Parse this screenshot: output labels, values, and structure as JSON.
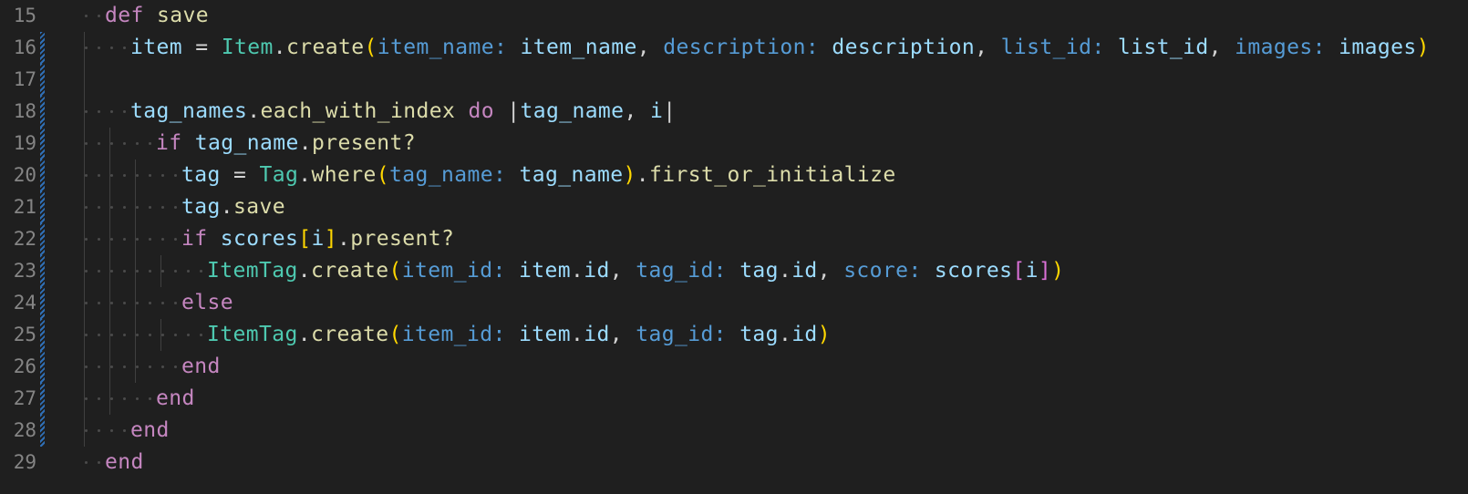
{
  "editor": {
    "language": "ruby",
    "theme_colors": {
      "background": "#1f1f1f",
      "line_number": "#858585",
      "keyword": "#c586c0",
      "function": "#dcdcaa",
      "class": "#4ec9b0",
      "variable": "#9cdcfe",
      "symbol_key": "#569cd6",
      "bracket_level1": "#ffd700",
      "bracket_level2": "#da70d6",
      "modified_gutter": "#2f6fb6"
    },
    "lines": [
      {
        "num": "15",
        "indent": 0,
        "modified": false,
        "tokens": [
          {
            "t": "def",
            "c": "kw"
          },
          {
            "t": " ",
            "c": "pun"
          },
          {
            "t": "save",
            "c": "fn"
          }
        ]
      },
      {
        "num": "16",
        "indent": 1,
        "modified": true,
        "tokens": [
          {
            "t": "item",
            "c": "var"
          },
          {
            "t": " = ",
            "c": "pun"
          },
          {
            "t": "Item",
            "c": "cls"
          },
          {
            "t": ".",
            "c": "pun"
          },
          {
            "t": "create",
            "c": "fn"
          },
          {
            "t": "(",
            "c": "br1"
          },
          {
            "t": "item_name:",
            "c": "sym"
          },
          {
            "t": " ",
            "c": "pun"
          },
          {
            "t": "item_name",
            "c": "var"
          },
          {
            "t": ", ",
            "c": "pun"
          },
          {
            "t": "description:",
            "c": "sym"
          },
          {
            "t": " ",
            "c": "pun"
          },
          {
            "t": "description",
            "c": "var"
          },
          {
            "t": ", ",
            "c": "pun"
          },
          {
            "t": "list_id:",
            "c": "sym"
          },
          {
            "t": " ",
            "c": "pun"
          },
          {
            "t": "list_id",
            "c": "var"
          },
          {
            "t": ", ",
            "c": "pun"
          },
          {
            "t": "images:",
            "c": "sym"
          },
          {
            "t": " ",
            "c": "pun"
          },
          {
            "t": "images",
            "c": "var"
          },
          {
            "t": ")",
            "c": "br1"
          }
        ]
      },
      {
        "num": "17",
        "indent": 0,
        "modified": true,
        "tokens": []
      },
      {
        "num": "18",
        "indent": 1,
        "modified": true,
        "tokens": [
          {
            "t": "tag_names",
            "c": "var"
          },
          {
            "t": ".",
            "c": "pun"
          },
          {
            "t": "each_with_index",
            "c": "fn"
          },
          {
            "t": " ",
            "c": "pun"
          },
          {
            "t": "do",
            "c": "kw"
          },
          {
            "t": " ",
            "c": "pun"
          },
          {
            "t": "|",
            "c": "pun"
          },
          {
            "t": "tag_name",
            "c": "var"
          },
          {
            "t": ", ",
            "c": "pun"
          },
          {
            "t": "i",
            "c": "var"
          },
          {
            "t": "|",
            "c": "pun"
          }
        ]
      },
      {
        "num": "19",
        "indent": 2,
        "modified": true,
        "tokens": [
          {
            "t": "if",
            "c": "kw"
          },
          {
            "t": " ",
            "c": "pun"
          },
          {
            "t": "tag_name",
            "c": "var"
          },
          {
            "t": ".",
            "c": "pun"
          },
          {
            "t": "present?",
            "c": "fn"
          }
        ]
      },
      {
        "num": "20",
        "indent": 3,
        "modified": true,
        "tokens": [
          {
            "t": "tag",
            "c": "var"
          },
          {
            "t": " = ",
            "c": "pun"
          },
          {
            "t": "Tag",
            "c": "cls"
          },
          {
            "t": ".",
            "c": "pun"
          },
          {
            "t": "where",
            "c": "fn"
          },
          {
            "t": "(",
            "c": "br1"
          },
          {
            "t": "tag_name:",
            "c": "sym"
          },
          {
            "t": " ",
            "c": "pun"
          },
          {
            "t": "tag_name",
            "c": "var"
          },
          {
            "t": ")",
            "c": "br1"
          },
          {
            "t": ".",
            "c": "pun"
          },
          {
            "t": "first_or_initialize",
            "c": "fn"
          }
        ]
      },
      {
        "num": "21",
        "indent": 3,
        "modified": true,
        "tokens": [
          {
            "t": "tag",
            "c": "var"
          },
          {
            "t": ".",
            "c": "pun"
          },
          {
            "t": "save",
            "c": "fn"
          }
        ]
      },
      {
        "num": "22",
        "indent": 3,
        "modified": true,
        "tokens": [
          {
            "t": "if",
            "c": "kw"
          },
          {
            "t": " ",
            "c": "pun"
          },
          {
            "t": "scores",
            "c": "var"
          },
          {
            "t": "[",
            "c": "br1"
          },
          {
            "t": "i",
            "c": "var"
          },
          {
            "t": "]",
            "c": "br1"
          },
          {
            "t": ".",
            "c": "pun"
          },
          {
            "t": "present?",
            "c": "fn"
          }
        ]
      },
      {
        "num": "23",
        "indent": 4,
        "modified": true,
        "tokens": [
          {
            "t": "ItemTag",
            "c": "cls"
          },
          {
            "t": ".",
            "c": "pun"
          },
          {
            "t": "create",
            "c": "fn"
          },
          {
            "t": "(",
            "c": "br1"
          },
          {
            "t": "item_id:",
            "c": "sym"
          },
          {
            "t": " ",
            "c": "pun"
          },
          {
            "t": "item",
            "c": "var"
          },
          {
            "t": ".",
            "c": "pun"
          },
          {
            "t": "id",
            "c": "var"
          },
          {
            "t": ", ",
            "c": "pun"
          },
          {
            "t": "tag_id:",
            "c": "sym"
          },
          {
            "t": " ",
            "c": "pun"
          },
          {
            "t": "tag",
            "c": "var"
          },
          {
            "t": ".",
            "c": "pun"
          },
          {
            "t": "id",
            "c": "var"
          },
          {
            "t": ", ",
            "c": "pun"
          },
          {
            "t": "score:",
            "c": "sym"
          },
          {
            "t": " ",
            "c": "pun"
          },
          {
            "t": "scores",
            "c": "var"
          },
          {
            "t": "[",
            "c": "br2"
          },
          {
            "t": "i",
            "c": "var"
          },
          {
            "t": "]",
            "c": "br2"
          },
          {
            "t": ")",
            "c": "br1"
          }
        ]
      },
      {
        "num": "24",
        "indent": 3,
        "modified": true,
        "tokens": [
          {
            "t": "else",
            "c": "kw"
          }
        ]
      },
      {
        "num": "25",
        "indent": 4,
        "modified": true,
        "tokens": [
          {
            "t": "ItemTag",
            "c": "cls"
          },
          {
            "t": ".",
            "c": "pun"
          },
          {
            "t": "create",
            "c": "fn"
          },
          {
            "t": "(",
            "c": "br1"
          },
          {
            "t": "item_id:",
            "c": "sym"
          },
          {
            "t": " ",
            "c": "pun"
          },
          {
            "t": "item",
            "c": "var"
          },
          {
            "t": ".",
            "c": "pun"
          },
          {
            "t": "id",
            "c": "var"
          },
          {
            "t": ", ",
            "c": "pun"
          },
          {
            "t": "tag_id:",
            "c": "sym"
          },
          {
            "t": " ",
            "c": "pun"
          },
          {
            "t": "tag",
            "c": "var"
          },
          {
            "t": ".",
            "c": "pun"
          },
          {
            "t": "id",
            "c": "var"
          },
          {
            "t": ")",
            "c": "br1"
          }
        ]
      },
      {
        "num": "26",
        "indent": 3,
        "modified": true,
        "tokens": [
          {
            "t": "end",
            "c": "kw"
          }
        ]
      },
      {
        "num": "27",
        "indent": 2,
        "modified": true,
        "tokens": [
          {
            "t": "end",
            "c": "kw"
          }
        ]
      },
      {
        "num": "28",
        "indent": 1,
        "modified": true,
        "tokens": [
          {
            "t": "end",
            "c": "kw"
          }
        ]
      },
      {
        "num": "29",
        "indent": 0,
        "modified": false,
        "tokens": [
          {
            "t": "end",
            "c": "kw"
          }
        ]
      }
    ]
  }
}
